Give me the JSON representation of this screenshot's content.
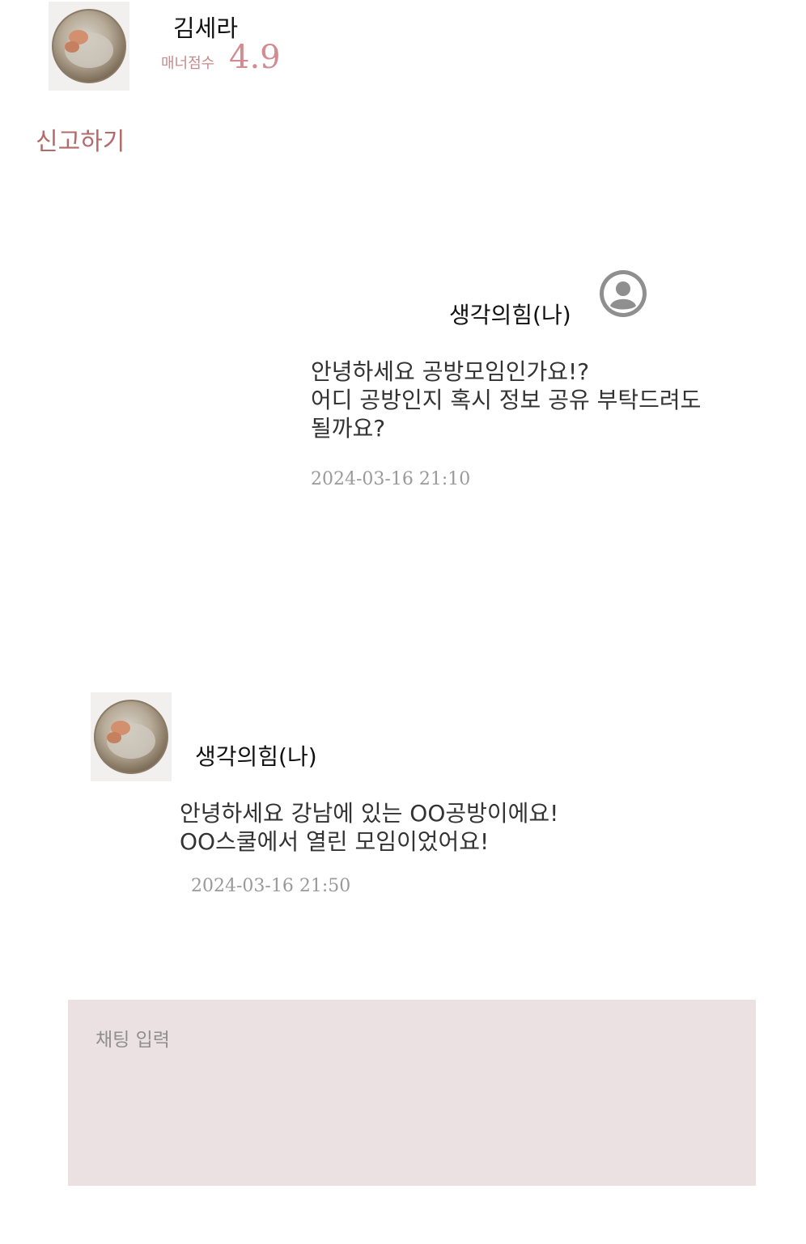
{
  "header": {
    "partner_name": "김세라",
    "manner_label": "매너점수",
    "manner_score": "4.9",
    "report_label": "신고하기"
  },
  "messages": [
    {
      "sender": "생각의힘(나)",
      "is_me": true,
      "lines": [
        "안녕하세요 공방모임인가요!?",
        "어디 공방인지 혹시 정보 공유 부탁드려도",
        "될까요?"
      ],
      "time": "2024-03-16 21:10"
    },
    {
      "sender": "생각의힘(나)",
      "is_me": false,
      "lines": [
        "안녕하세요 강남에 있는 OO공방이에요!",
        "OO스쿨에서 열린 모임이었어요!"
      ],
      "time": "2024-03-16 21:50"
    }
  ],
  "input": {
    "placeholder": "채팅 입력",
    "value": ""
  },
  "icons": {
    "partner_avatar": "profile-photo",
    "my_avatar": "user-circle-icon"
  },
  "colors": {
    "accent": "#d48b90",
    "report": "#b36a6a",
    "input_bg": "#ebe1e2",
    "time": "#9a9a9a"
  }
}
